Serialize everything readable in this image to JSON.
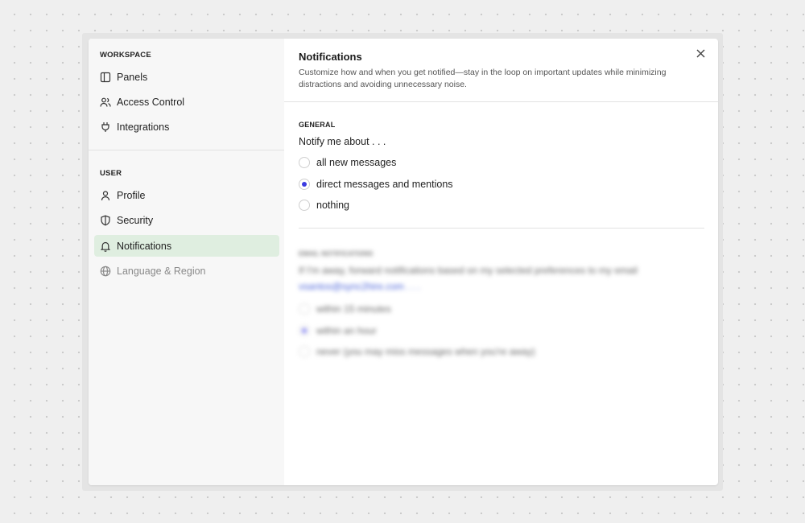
{
  "sidebar": {
    "workspace_title": "WORKSPACE",
    "workspace_items": [
      {
        "label": "Panels",
        "icon": "panels-icon"
      },
      {
        "label": "Access Control",
        "icon": "users-icon"
      },
      {
        "label": "Integrations",
        "icon": "plug-icon"
      }
    ],
    "user_title": "USER",
    "user_items": [
      {
        "label": "Profile",
        "icon": "user-icon"
      },
      {
        "label": "Security",
        "icon": "shield-icon"
      },
      {
        "label": "Notifications",
        "icon": "bell-icon",
        "active": true
      },
      {
        "label": "Language & Region",
        "icon": "globe-icon",
        "disabled": true
      }
    ]
  },
  "main": {
    "title": "Notifications",
    "description": "Customize how and when you get notified—stay in the loop on important updates while minimizing distractions and avoiding unnecessary noise.",
    "general": {
      "label": "GENERAL",
      "question": "Notify me about . . .",
      "options": [
        "all new messages",
        "direct messages and mentions",
        "nothing"
      ],
      "selected": "direct messages and mentions"
    },
    "email_notifications": {
      "label": "EMAIL NOTIFICATIONS",
      "question": "If I'm away, forward notifications based on my selected preferences to my email",
      "email": "vsantos@sync2hire.com",
      "email_suffix": ". . .",
      "options": [
        "within 15 minutes",
        "within an hour",
        "never (you may miss messages when you're away)"
      ],
      "selected": "within an hour"
    }
  },
  "colors": {
    "accent": "#3b3be0",
    "active_nav_bg": "#dfeee0",
    "link": "#4a63d9"
  }
}
